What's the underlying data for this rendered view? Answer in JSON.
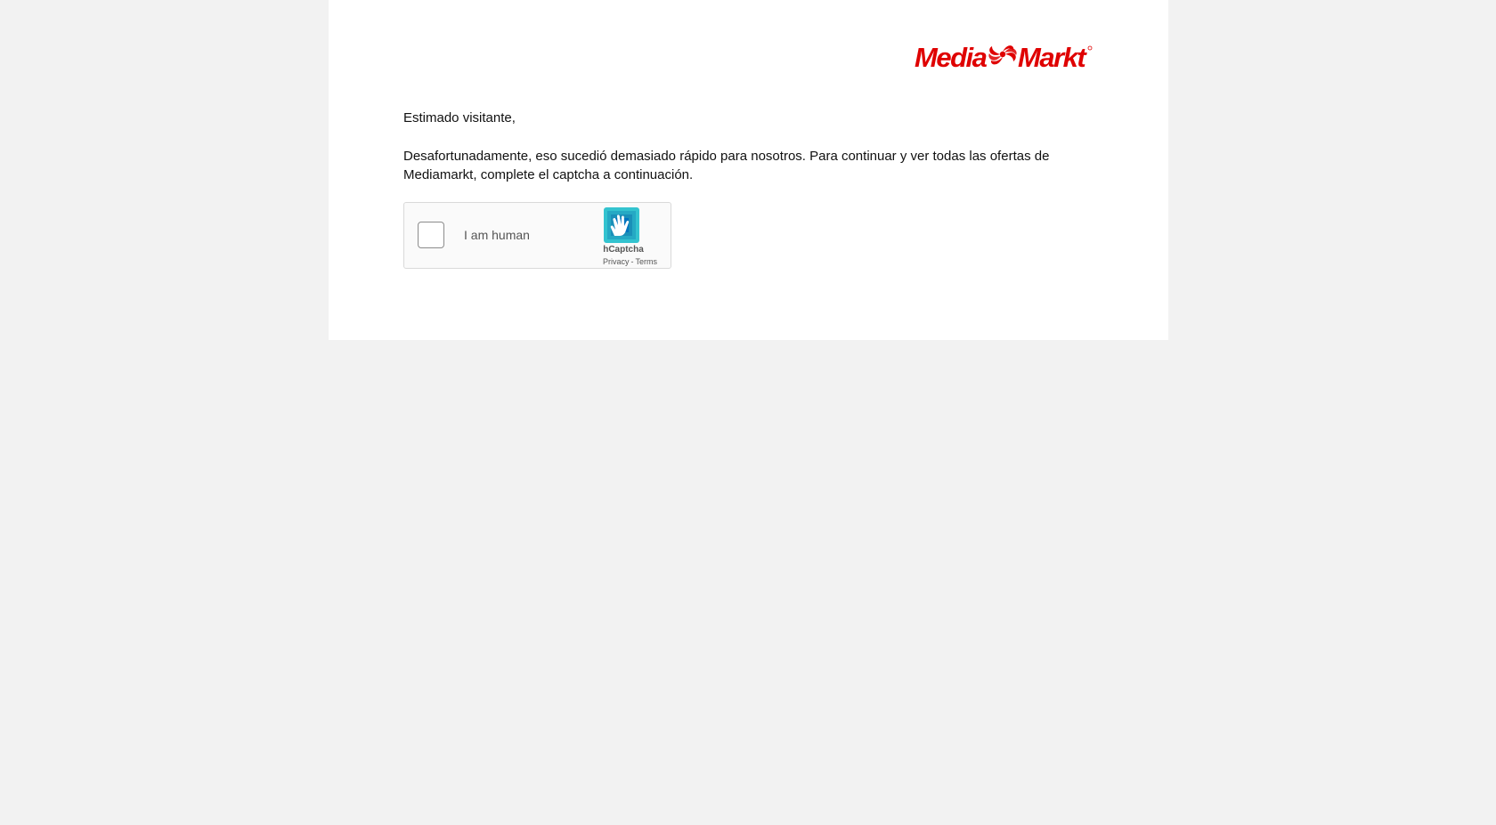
{
  "brand": {
    "logo_text": "MediaMarkt",
    "color": "#df0000"
  },
  "content": {
    "greeting": "Estimado visitante,",
    "message": "Desafortunadamente, eso sucedió demasiado rápido para nosotros. Para continuar y ver todas las ofertas de Mediamarkt, complete el captcha a continuación."
  },
  "captcha": {
    "checkbox_label": "I am human",
    "checked": false,
    "provider_name": "hCaptcha",
    "privacy_link": "Privacy",
    "separator": "-",
    "terms_link": "Terms",
    "icon": "hcaptcha-hand-icon",
    "accent_color": "#0074bf"
  }
}
